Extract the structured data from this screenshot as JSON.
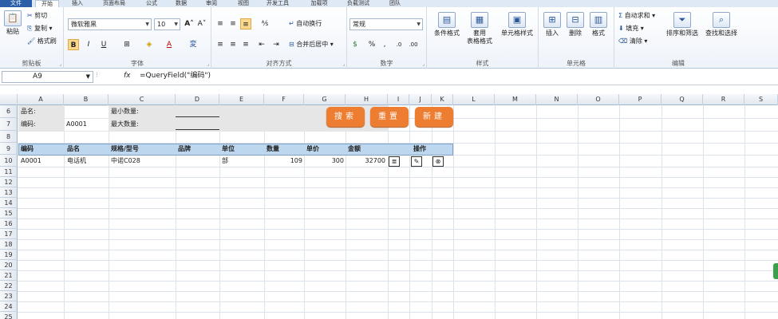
{
  "tabs": [
    "文件",
    "开始",
    "插入",
    "页面布局",
    "公式",
    "数据",
    "审阅",
    "视图",
    "开发工具",
    "加载项",
    "负载测试",
    "团队"
  ],
  "clipboard": {
    "paste": "粘贴",
    "cut": "剪切",
    "copy": "复制",
    "format_painter": "格式刷",
    "label": "剪贴板"
  },
  "font": {
    "name": "微软雅黑",
    "size": "10",
    "label": "字体",
    "bold": "B",
    "italic": "I",
    "underline": "U"
  },
  "alignment": {
    "wrap": "自动换行",
    "merge": "合并后居中",
    "label": "对齐方式"
  },
  "number": {
    "format": "常规",
    "label": "数字"
  },
  "styles": {
    "cond": "条件格式",
    "table": "套用\n表格格式",
    "cell": "单元格样式",
    "label": "样式"
  },
  "cells": {
    "insert": "插入",
    "delete": "删除",
    "format": "格式",
    "label": "单元格"
  },
  "editing": {
    "autosum": "自动求和",
    "fill": "填充",
    "clear": "清除",
    "sort": "排序和筛选",
    "find": "查找和选择",
    "label": "编辑"
  },
  "formula_bar": {
    "cell_ref": "A9",
    "fx": "fx",
    "formula": "=QueryField(\"编码\")"
  },
  "columns": [
    "A",
    "B",
    "C",
    "D",
    "E",
    "F",
    "G",
    "H",
    "I",
    "J",
    "K",
    "L",
    "M",
    "N",
    "O",
    "P",
    "Q",
    "R",
    "S"
  ],
  "rows": [
    "6",
    "7",
    "8",
    "9",
    "10",
    "11",
    "12",
    "13",
    "14",
    "15",
    "16",
    "17",
    "18",
    "19",
    "20",
    "21",
    "22",
    "23",
    "24",
    "25"
  ],
  "form": {
    "name_label": "品名:",
    "code_label": "编码:",
    "code_value": "A0001",
    "min_label": "最小数量:",
    "max_label": "最大数量:"
  },
  "buttons": {
    "search": "搜索",
    "reset": "重置",
    "new": "新建"
  },
  "table": {
    "headers": [
      "编码",
      "品名",
      "规格/型号",
      "品牌",
      "单位",
      "数量",
      "单价",
      "金额",
      "操作"
    ],
    "row": {
      "code": "A0001",
      "name": "电话机",
      "spec": "中诺C028",
      "brand": "",
      "unit": "部",
      "qty": "109",
      "price": "300",
      "amount": "32700"
    }
  },
  "colors": {
    "accent": "#ed7d31",
    "header_fill": "#bdd7ee",
    "form_fill": "#e7e6e6"
  }
}
